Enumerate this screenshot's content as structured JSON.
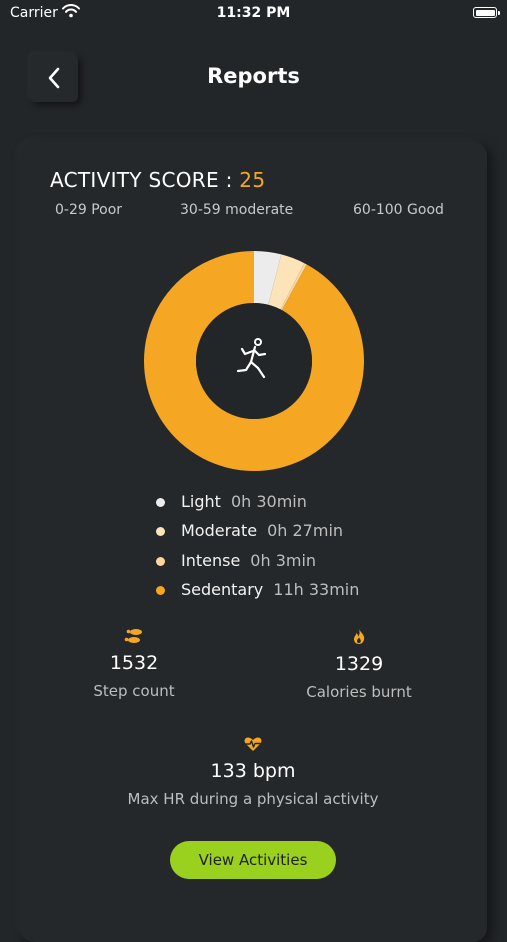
{
  "status_bar": {
    "carrier": "Carrier",
    "time": "11:32 PM"
  },
  "header": {
    "title": "Reports",
    "back_icon": "chevron-left-icon"
  },
  "score": {
    "label": "ACTIVITY SCORE :",
    "value": "25",
    "ranges": [
      "0-29 Poor",
      "30-59 moderate",
      "60-100 Good"
    ]
  },
  "chart_data": {
    "type": "pie",
    "center_icon": "running-person-icon",
    "categories": [
      "Light",
      "Moderate",
      "Intense",
      "Sedentary"
    ],
    "values": [
      30,
      27,
      3,
      693
    ],
    "colors": [
      "#ececec",
      "#fde3b8",
      "#fbd79a",
      "#f5a623"
    ]
  },
  "legend": [
    {
      "label": "Light",
      "value": "0h 30min",
      "color": "#ececec"
    },
    {
      "label": "Moderate",
      "value": "0h 27min",
      "color": "#fde3b8"
    },
    {
      "label": "Intense",
      "value": "0h 3min",
      "color": "#fbd79a"
    },
    {
      "label": "Sedentary",
      "value": "11h 33min",
      "color": "#f5a623"
    }
  ],
  "stats": {
    "steps": {
      "icon": "footsteps-icon",
      "value": "1532",
      "label": "Step count"
    },
    "calories": {
      "icon": "flame-icon",
      "value": "1329",
      "label": "Calories burnt"
    },
    "heart": {
      "icon": "heart-rate-icon",
      "value": "133 bpm",
      "label": "Max HR during a physical activity"
    }
  },
  "actions": {
    "view_activities": "View Activities"
  },
  "colors": {
    "accent": "#f5a623",
    "button": "#9ad11e",
    "background": "#232629",
    "card": "#25282b"
  }
}
